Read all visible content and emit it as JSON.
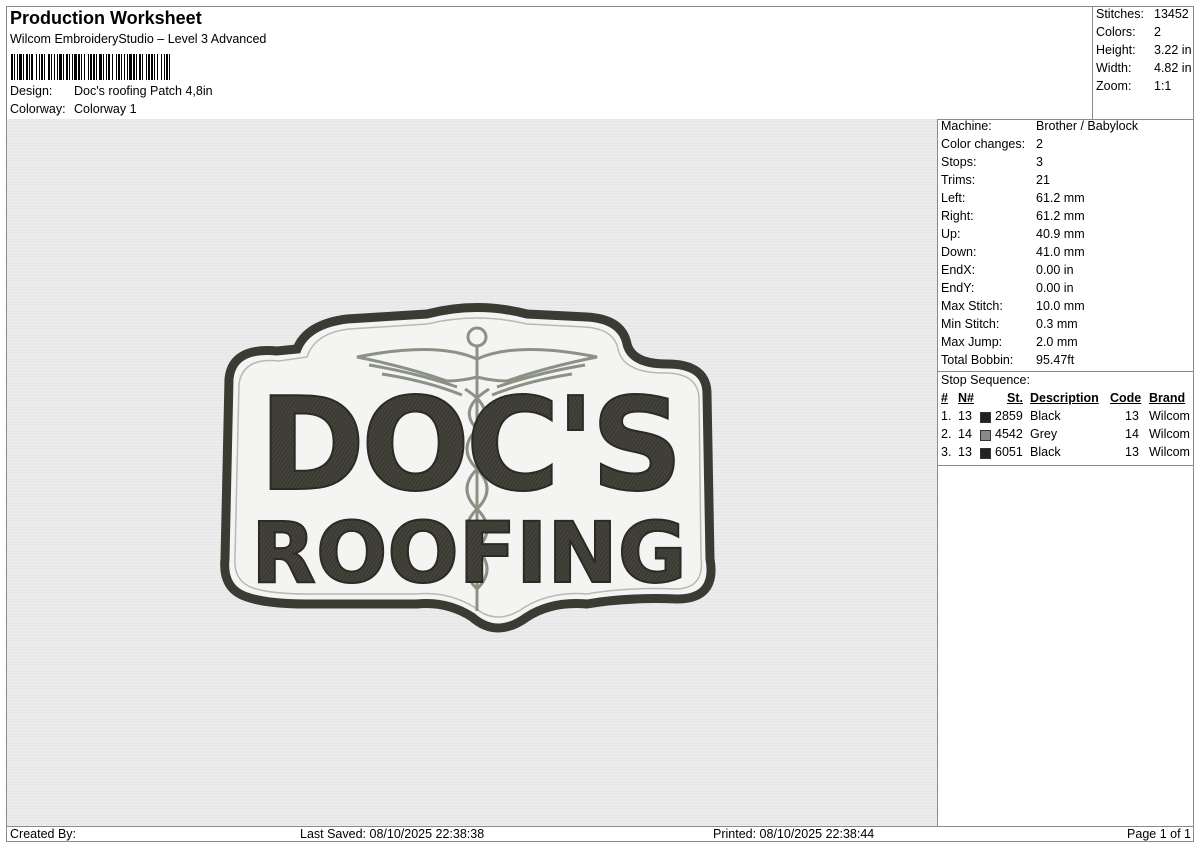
{
  "header": {
    "title": "Production Worksheet",
    "subtitle": "Wilcom EmbroideryStudio – Level 3 Advanced",
    "design_label": "Design:",
    "design_value": "Doc's roofing Patch 4,8in",
    "colorway_label": "Colorway:",
    "colorway_value": "Colorway 1"
  },
  "summary": [
    {
      "label": "Stitches:",
      "value": "13452"
    },
    {
      "label": "Colors:",
      "value": "2"
    },
    {
      "label": "Height:",
      "value": "3.22 in"
    },
    {
      "label": "Width:",
      "value": "4.82 in"
    },
    {
      "label": "Zoom:",
      "value": "1:1"
    }
  ],
  "design": {
    "line1": "DOC'S",
    "line2": "ROOFING",
    "thread_dark": "#3b3a33",
    "thread_grey": "#8c9186",
    "patch_fill": "#f4f4f2",
    "canvas_bg": "#e8e8e8"
  },
  "machine_info": [
    {
      "label": "Machine:",
      "value": "Brother / Babylock"
    },
    {
      "label": "Color changes:",
      "value": "2"
    },
    {
      "label": "Stops:",
      "value": "3"
    },
    {
      "label": "Trims:",
      "value": "21"
    },
    {
      "label": "Left:",
      "value": "61.2 mm"
    },
    {
      "label": "Right:",
      "value": "61.2 mm"
    },
    {
      "label": "Up:",
      "value": "40.9 mm"
    },
    {
      "label": "Down:",
      "value": "41.0 mm"
    },
    {
      "label": "EndX:",
      "value": "0.00 in"
    },
    {
      "label": "EndY:",
      "value": "0.00 in"
    },
    {
      "label": "Max Stitch:",
      "value": "10.0 mm"
    },
    {
      "label": "Min Stitch:",
      "value": "0.3 mm"
    },
    {
      "label": "Max Jump:",
      "value": "2.0 mm"
    },
    {
      "label": "Total Bobbin:",
      "value": "95.47ft"
    }
  ],
  "stop_sequence": {
    "title": "Stop Sequence:",
    "headers": {
      "num": "#",
      "n": "N#",
      "st": "St.",
      "desc": "Description",
      "code": "Code",
      "brand": "Brand"
    },
    "rows": [
      {
        "num": "1.",
        "n": "13",
        "color": "#222222",
        "st": "2859",
        "desc": "Black",
        "code": "13",
        "brand": "Wilcom"
      },
      {
        "num": "2.",
        "n": "14",
        "color": "#8a8a8a",
        "st": "4542",
        "desc": "Grey",
        "code": "14",
        "brand": "Wilcom"
      },
      {
        "num": "3.",
        "n": "13",
        "color": "#222222",
        "st": "6051",
        "desc": "Black",
        "code": "13",
        "brand": "Wilcom"
      }
    ]
  },
  "footer": {
    "created": "Created By:",
    "saved": "Last Saved: 08/10/2025 22:38:38",
    "printed": "Printed: 08/10/2025 22:38:44",
    "page": "Page 1 of 1"
  }
}
